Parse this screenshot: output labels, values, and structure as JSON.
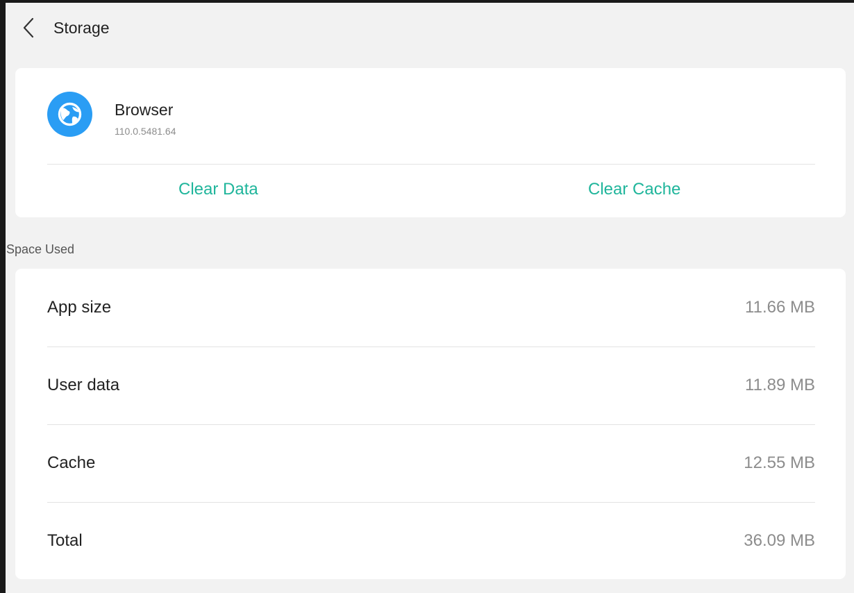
{
  "header": {
    "back_icon": "chevron-left-icon",
    "title": "Storage"
  },
  "app": {
    "icon": "globe-icon",
    "icon_color": "#2a9df4",
    "name": "Browser",
    "version": "110.0.5481.64",
    "actions": {
      "clear_data": "Clear Data",
      "clear_cache": "Clear Cache"
    }
  },
  "space_used": {
    "heading": "Space Used",
    "rows": [
      {
        "label": "App size",
        "value": "11.66 MB"
      },
      {
        "label": "User data",
        "value": "11.89 MB"
      },
      {
        "label": "Cache",
        "value": "12.55 MB"
      },
      {
        "label": "Total",
        "value": "36.09 MB"
      }
    ]
  },
  "colors": {
    "accent": "#1fb59b",
    "background": "#f2f2f2",
    "card": "#ffffff"
  }
}
